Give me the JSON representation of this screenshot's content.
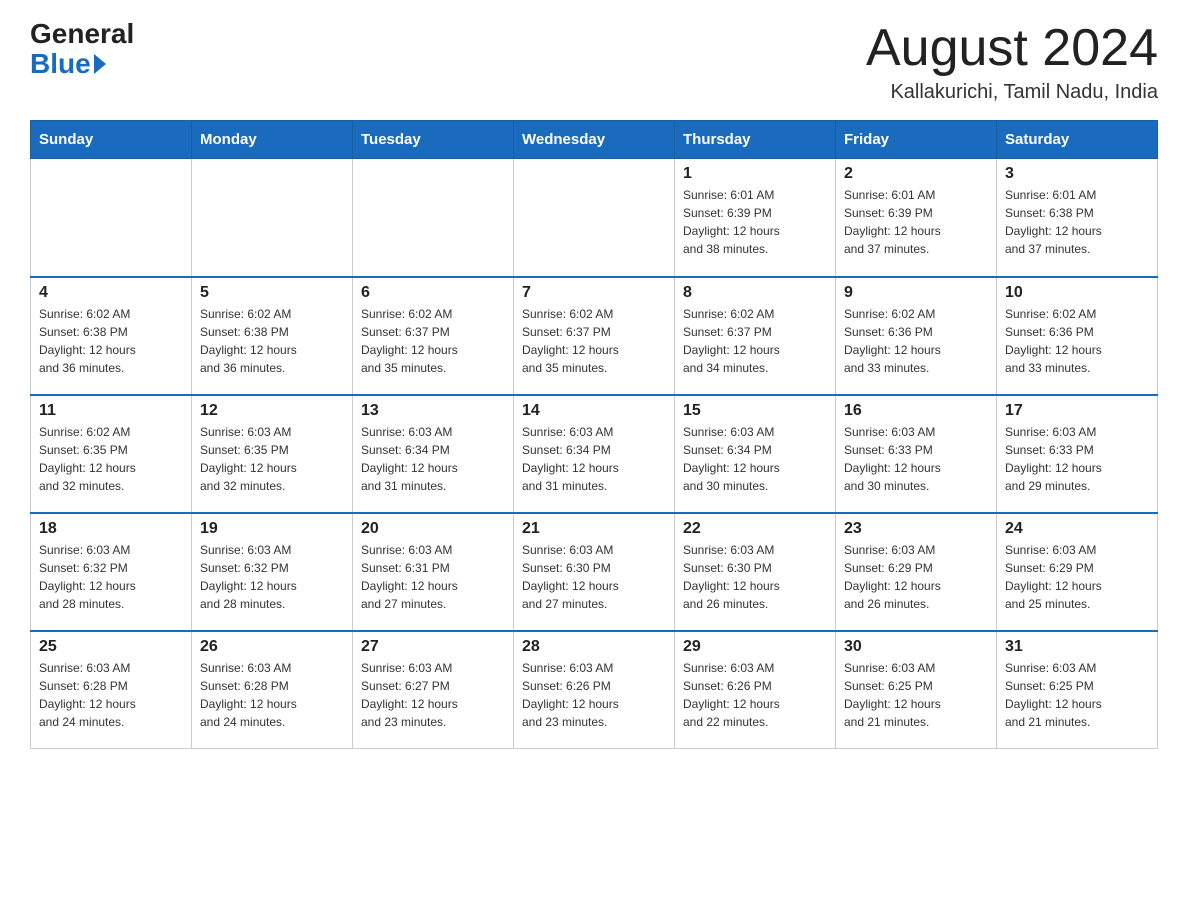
{
  "header": {
    "logo_general": "General",
    "logo_blue": "Blue",
    "month_year": "August 2024",
    "location": "Kallakurichi, Tamil Nadu, India"
  },
  "days_of_week": [
    "Sunday",
    "Monday",
    "Tuesday",
    "Wednesday",
    "Thursday",
    "Friday",
    "Saturday"
  ],
  "weeks": [
    [
      {
        "day": "",
        "info": ""
      },
      {
        "day": "",
        "info": ""
      },
      {
        "day": "",
        "info": ""
      },
      {
        "day": "",
        "info": ""
      },
      {
        "day": "1",
        "info": "Sunrise: 6:01 AM\nSunset: 6:39 PM\nDaylight: 12 hours\nand 38 minutes."
      },
      {
        "day": "2",
        "info": "Sunrise: 6:01 AM\nSunset: 6:39 PM\nDaylight: 12 hours\nand 37 minutes."
      },
      {
        "day": "3",
        "info": "Sunrise: 6:01 AM\nSunset: 6:38 PM\nDaylight: 12 hours\nand 37 minutes."
      }
    ],
    [
      {
        "day": "4",
        "info": "Sunrise: 6:02 AM\nSunset: 6:38 PM\nDaylight: 12 hours\nand 36 minutes."
      },
      {
        "day": "5",
        "info": "Sunrise: 6:02 AM\nSunset: 6:38 PM\nDaylight: 12 hours\nand 36 minutes."
      },
      {
        "day": "6",
        "info": "Sunrise: 6:02 AM\nSunset: 6:37 PM\nDaylight: 12 hours\nand 35 minutes."
      },
      {
        "day": "7",
        "info": "Sunrise: 6:02 AM\nSunset: 6:37 PM\nDaylight: 12 hours\nand 35 minutes."
      },
      {
        "day": "8",
        "info": "Sunrise: 6:02 AM\nSunset: 6:37 PM\nDaylight: 12 hours\nand 34 minutes."
      },
      {
        "day": "9",
        "info": "Sunrise: 6:02 AM\nSunset: 6:36 PM\nDaylight: 12 hours\nand 33 minutes."
      },
      {
        "day": "10",
        "info": "Sunrise: 6:02 AM\nSunset: 6:36 PM\nDaylight: 12 hours\nand 33 minutes."
      }
    ],
    [
      {
        "day": "11",
        "info": "Sunrise: 6:02 AM\nSunset: 6:35 PM\nDaylight: 12 hours\nand 32 minutes."
      },
      {
        "day": "12",
        "info": "Sunrise: 6:03 AM\nSunset: 6:35 PM\nDaylight: 12 hours\nand 32 minutes."
      },
      {
        "day": "13",
        "info": "Sunrise: 6:03 AM\nSunset: 6:34 PM\nDaylight: 12 hours\nand 31 minutes."
      },
      {
        "day": "14",
        "info": "Sunrise: 6:03 AM\nSunset: 6:34 PM\nDaylight: 12 hours\nand 31 minutes."
      },
      {
        "day": "15",
        "info": "Sunrise: 6:03 AM\nSunset: 6:34 PM\nDaylight: 12 hours\nand 30 minutes."
      },
      {
        "day": "16",
        "info": "Sunrise: 6:03 AM\nSunset: 6:33 PM\nDaylight: 12 hours\nand 30 minutes."
      },
      {
        "day": "17",
        "info": "Sunrise: 6:03 AM\nSunset: 6:33 PM\nDaylight: 12 hours\nand 29 minutes."
      }
    ],
    [
      {
        "day": "18",
        "info": "Sunrise: 6:03 AM\nSunset: 6:32 PM\nDaylight: 12 hours\nand 28 minutes."
      },
      {
        "day": "19",
        "info": "Sunrise: 6:03 AM\nSunset: 6:32 PM\nDaylight: 12 hours\nand 28 minutes."
      },
      {
        "day": "20",
        "info": "Sunrise: 6:03 AM\nSunset: 6:31 PM\nDaylight: 12 hours\nand 27 minutes."
      },
      {
        "day": "21",
        "info": "Sunrise: 6:03 AM\nSunset: 6:30 PM\nDaylight: 12 hours\nand 27 minutes."
      },
      {
        "day": "22",
        "info": "Sunrise: 6:03 AM\nSunset: 6:30 PM\nDaylight: 12 hours\nand 26 minutes."
      },
      {
        "day": "23",
        "info": "Sunrise: 6:03 AM\nSunset: 6:29 PM\nDaylight: 12 hours\nand 26 minutes."
      },
      {
        "day": "24",
        "info": "Sunrise: 6:03 AM\nSunset: 6:29 PM\nDaylight: 12 hours\nand 25 minutes."
      }
    ],
    [
      {
        "day": "25",
        "info": "Sunrise: 6:03 AM\nSunset: 6:28 PM\nDaylight: 12 hours\nand 24 minutes."
      },
      {
        "day": "26",
        "info": "Sunrise: 6:03 AM\nSunset: 6:28 PM\nDaylight: 12 hours\nand 24 minutes."
      },
      {
        "day": "27",
        "info": "Sunrise: 6:03 AM\nSunset: 6:27 PM\nDaylight: 12 hours\nand 23 minutes."
      },
      {
        "day": "28",
        "info": "Sunrise: 6:03 AM\nSunset: 6:26 PM\nDaylight: 12 hours\nand 23 minutes."
      },
      {
        "day": "29",
        "info": "Sunrise: 6:03 AM\nSunset: 6:26 PM\nDaylight: 12 hours\nand 22 minutes."
      },
      {
        "day": "30",
        "info": "Sunrise: 6:03 AM\nSunset: 6:25 PM\nDaylight: 12 hours\nand 21 minutes."
      },
      {
        "day": "31",
        "info": "Sunrise: 6:03 AM\nSunset: 6:25 PM\nDaylight: 12 hours\nand 21 minutes."
      }
    ]
  ]
}
